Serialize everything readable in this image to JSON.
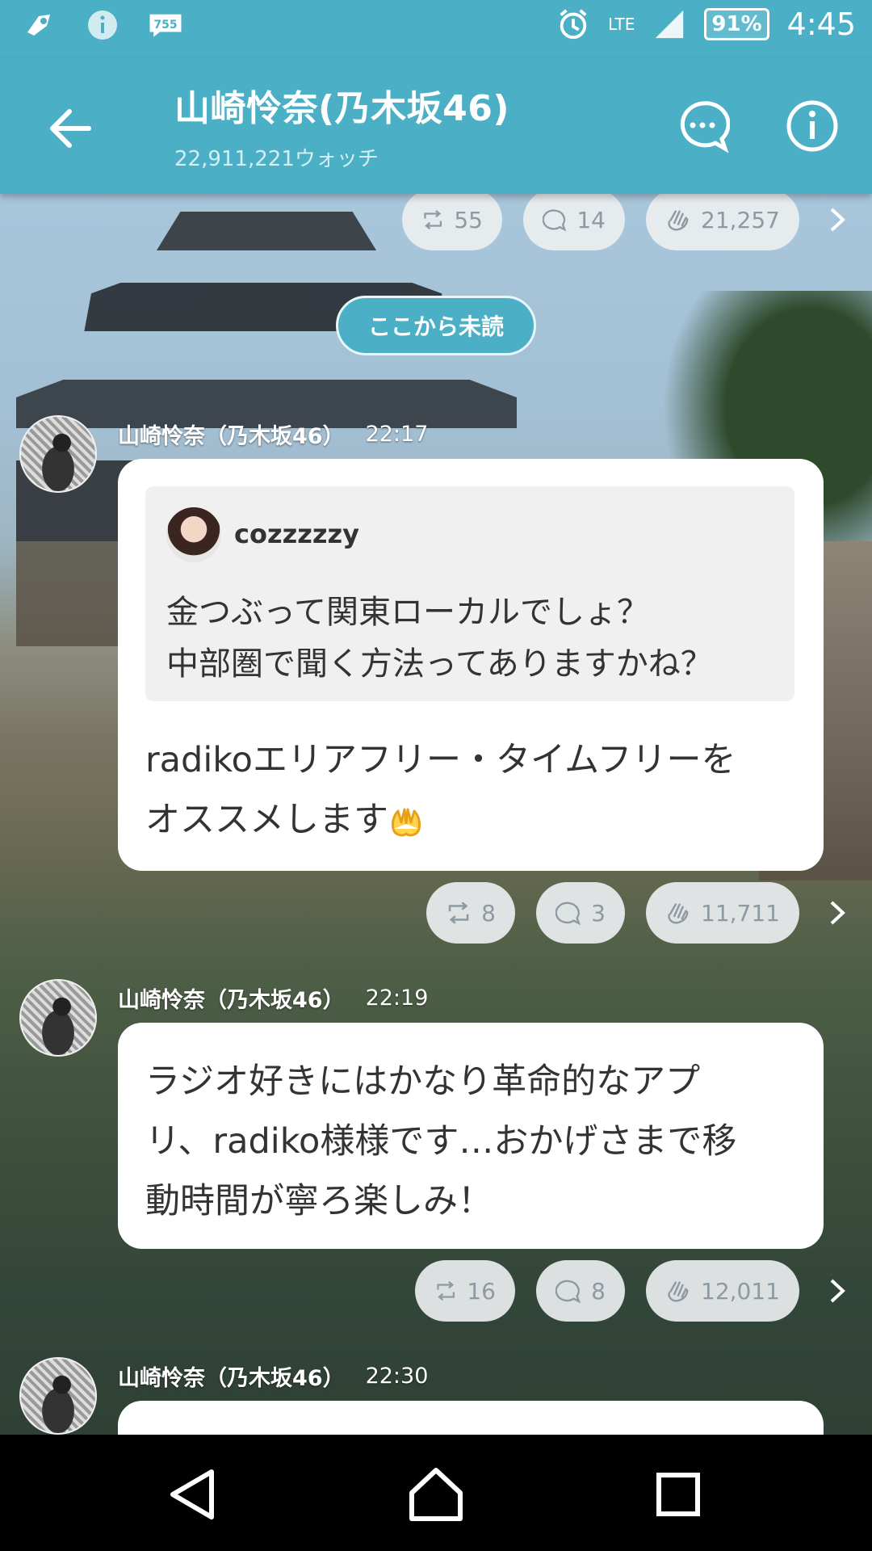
{
  "status_bar": {
    "battery": "91%",
    "network": "LTE",
    "time": "4:45"
  },
  "header": {
    "title": "山崎怜奈(乃木坂46)",
    "subtitle": "22,911,221ウォッチ"
  },
  "top_reactions": {
    "repost": "55",
    "comment": "14",
    "clap": "21,257"
  },
  "unread_label": "ここから未読",
  "messages": [
    {
      "author": "山崎怜奈（乃木坂46）",
      "time": "22:17",
      "quote": {
        "user": "cozzzzzy",
        "line1": "金つぶって関東ローカルでしょ？",
        "line2": "中部圏で聞く方法ってありますかね？"
      },
      "line1": "radikoエリアフリー・タイムフリーを",
      "line2": "オススメします",
      "reactions": {
        "repost": "8",
        "comment": "3",
        "clap": "11,711"
      }
    },
    {
      "author": "山崎怜奈（乃木坂46）",
      "time": "22:19",
      "line1": "ラジオ好きにはかなり革命的なアプ",
      "line2": "リ、radiko様様です…おかげさまで移",
      "line3": "動時間が寧ろ楽しみ！",
      "reactions": {
        "repost": "16",
        "comment": "8",
        "clap": "12,011"
      }
    },
    {
      "author": "山崎怜奈（乃木坂46）",
      "time": "22:30"
    }
  ],
  "colors": {
    "accent": "#4bb0c6",
    "pill_bg": "#ebeef0",
    "pill_text": "#8d9aa3"
  }
}
